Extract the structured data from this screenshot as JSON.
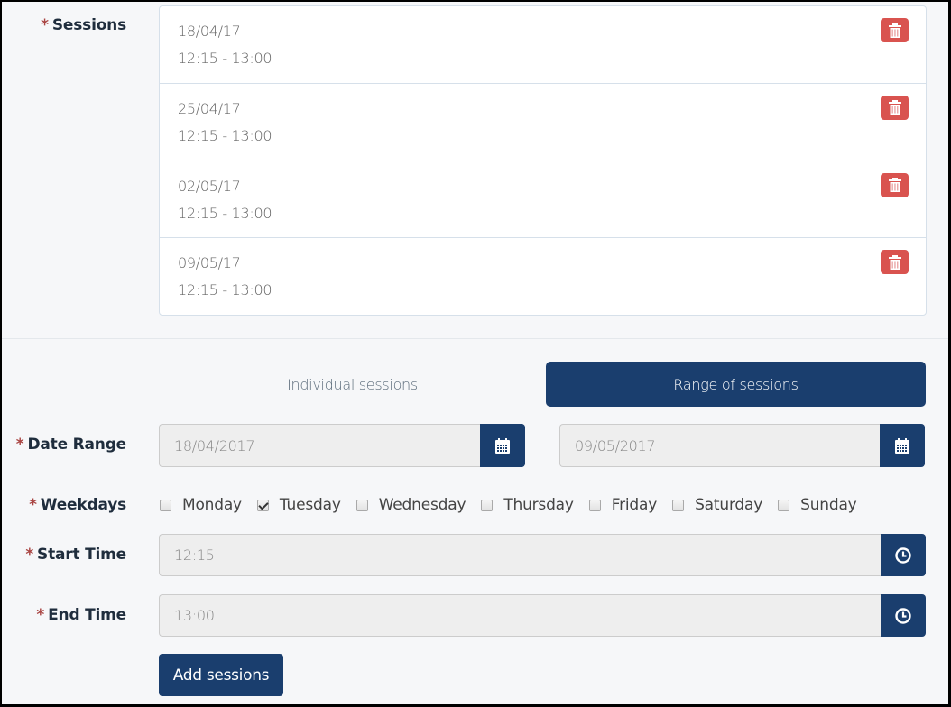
{
  "sessions": {
    "label": "Sessions",
    "required_mark": "*",
    "items": [
      {
        "date": "18/04/17",
        "time": "12:15 - 13:00"
      },
      {
        "date": "25/04/17",
        "time": "12:15 - 13:00"
      },
      {
        "date": "02/05/17",
        "time": "12:15 - 13:00"
      },
      {
        "date": "09/05/17",
        "time": "12:15 - 13:00"
      }
    ],
    "delete_icon": "trash-icon"
  },
  "tabs": {
    "individual": "Individual sessions",
    "range": "Range of sessions",
    "active": "range"
  },
  "date_range": {
    "label": "Date Range",
    "required_mark": "*",
    "start": "18/04/2017",
    "end": "09/05/2017",
    "icon": "calendar-icon"
  },
  "weekdays": {
    "label": "Weekdays",
    "required_mark": "*",
    "days": [
      {
        "name": "Monday",
        "checked": false
      },
      {
        "name": "Tuesday",
        "checked": true
      },
      {
        "name": "Wednesday",
        "checked": false
      },
      {
        "name": "Thursday",
        "checked": false
      },
      {
        "name": "Friday",
        "checked": false
      },
      {
        "name": "Saturday",
        "checked": false
      },
      {
        "name": "Sunday",
        "checked": false
      }
    ]
  },
  "start_time": {
    "label": "Start Time",
    "required_mark": "*",
    "value": "12:15",
    "icon": "clock-icon"
  },
  "end_time": {
    "label": "End Time",
    "required_mark": "*",
    "value": "13:00",
    "icon": "clock-icon"
  },
  "add_button": "Add sessions",
  "colors": {
    "primary": "#1a3e6e",
    "danger": "#d9534f",
    "required": "#a94442"
  }
}
